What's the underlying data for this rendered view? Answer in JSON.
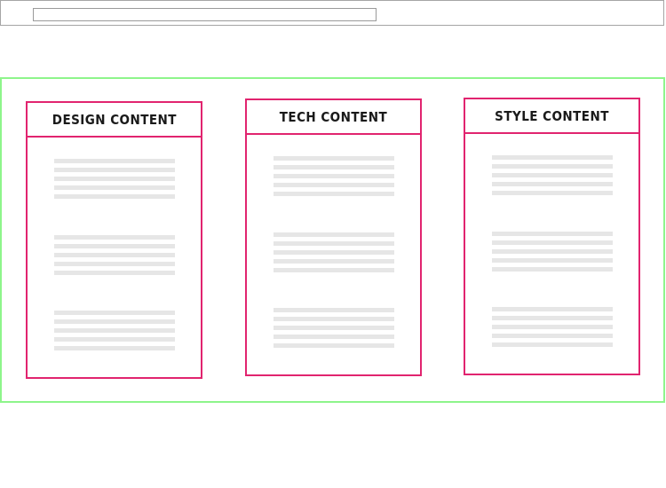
{
  "cards": [
    {
      "title": "DESIGN CONTENT"
    },
    {
      "title": "TECH CONTENT"
    },
    {
      "title": "STYLE CONTENT"
    }
  ],
  "colors": {
    "container_border": "#8ef58b",
    "card_border": "#e1246f",
    "placeholder_line": "#e6e6e6",
    "browser_frame": "#a5a5a5"
  }
}
